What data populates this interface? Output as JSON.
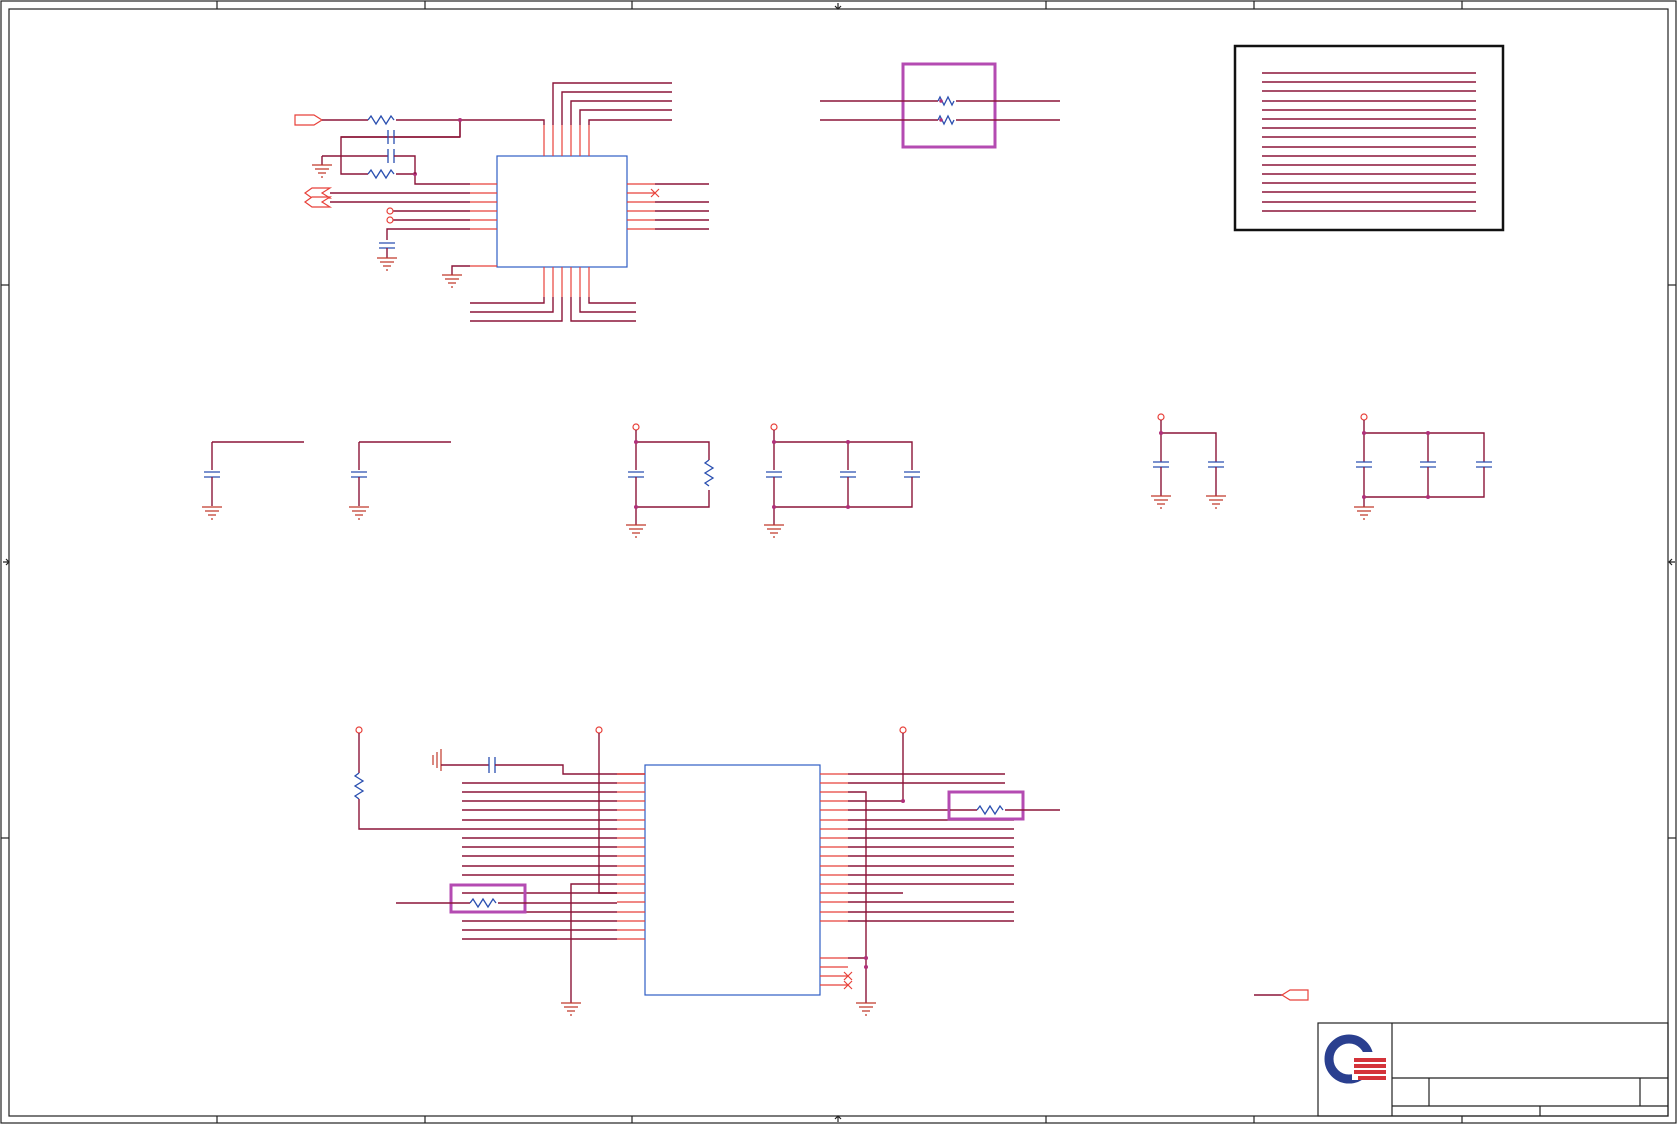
{
  "sheet": {
    "description_visible_text": "",
    "colors": {
      "wire": "#8b1538",
      "pin": "#e8413a",
      "component": "#2a4fb0",
      "ic_outline": "#2f5ec4",
      "highlight": "#b44bb2",
      "logo_blue": "#2a3f8f",
      "logo_red": "#d4333a"
    },
    "icons": {
      "logo": "company-logo-icon",
      "ground": "ground-symbol-icon",
      "power": "power-port-icon",
      "resistor": "resistor-icon",
      "capacitor": "capacitor-icon",
      "no_connect": "no-connect-icon"
    }
  },
  "title_block": {
    "title": "",
    "doc_number": "",
    "rev": "",
    "sheet": "",
    "date": ""
  }
}
